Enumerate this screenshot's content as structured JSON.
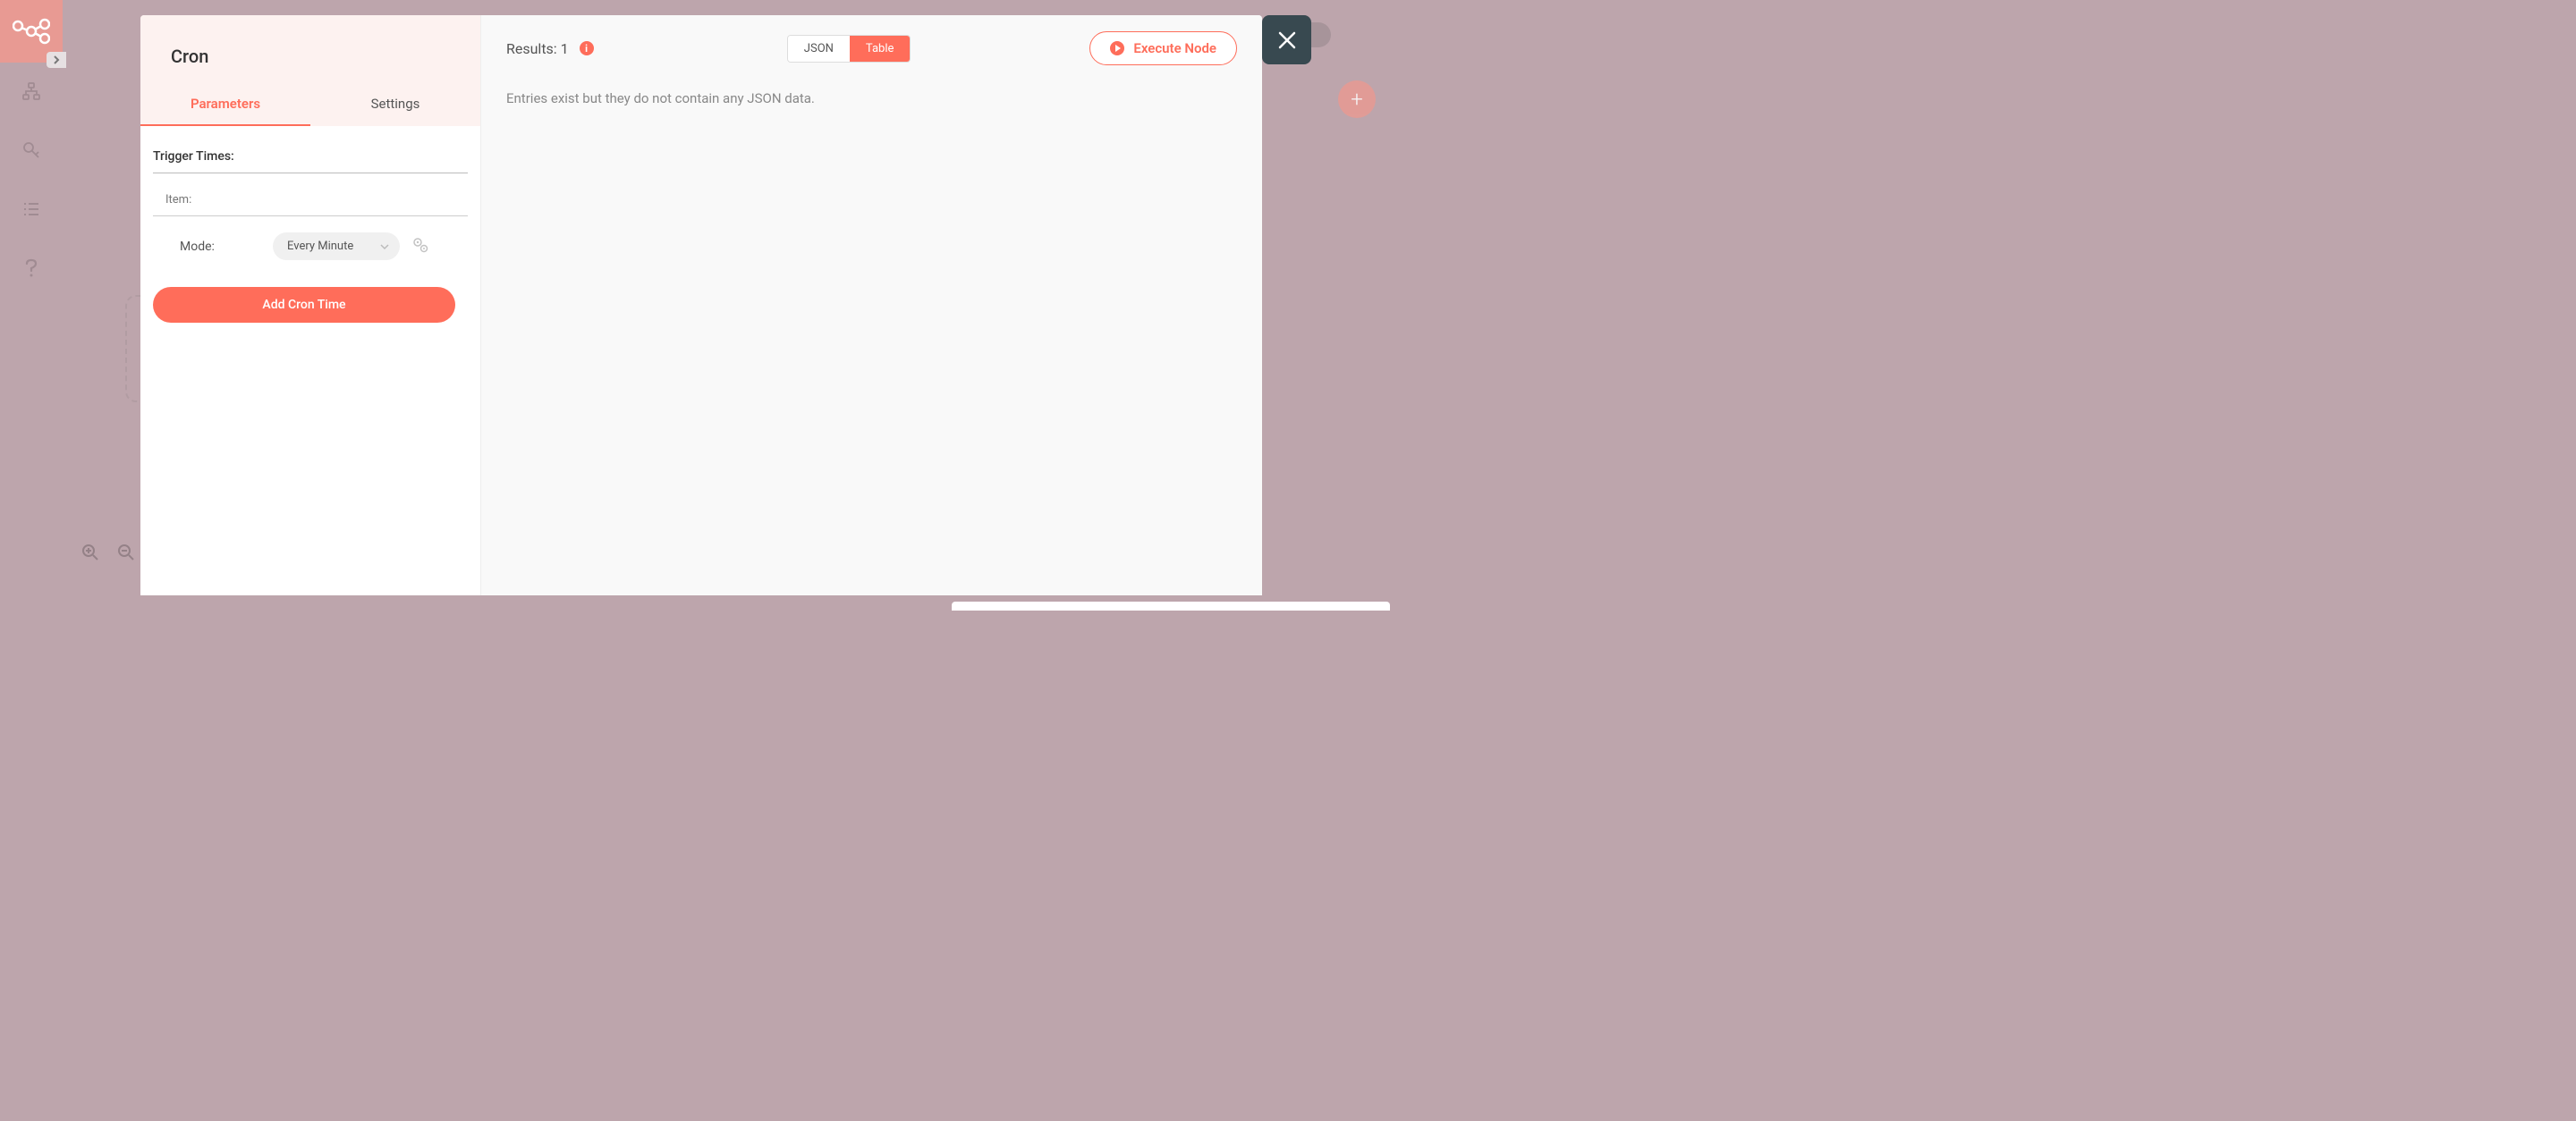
{
  "modal": {
    "title": "Cron",
    "tabs": {
      "parameters": "Parameters",
      "settings": "Settings"
    },
    "section": {
      "trigger_times": "Trigger Times:",
      "item": "Item:"
    },
    "field": {
      "mode_label": "Mode:",
      "mode_value": "Every Minute"
    },
    "add_button": "Add Cron Time",
    "execute_button": "Execute Node"
  },
  "results": {
    "label": "Results: 1",
    "view_json": "JSON",
    "view_table": "Table",
    "empty_message": "Entries exist but they do not contain any JSON data."
  },
  "info_glyph": "i",
  "fab_glyph": "+"
}
